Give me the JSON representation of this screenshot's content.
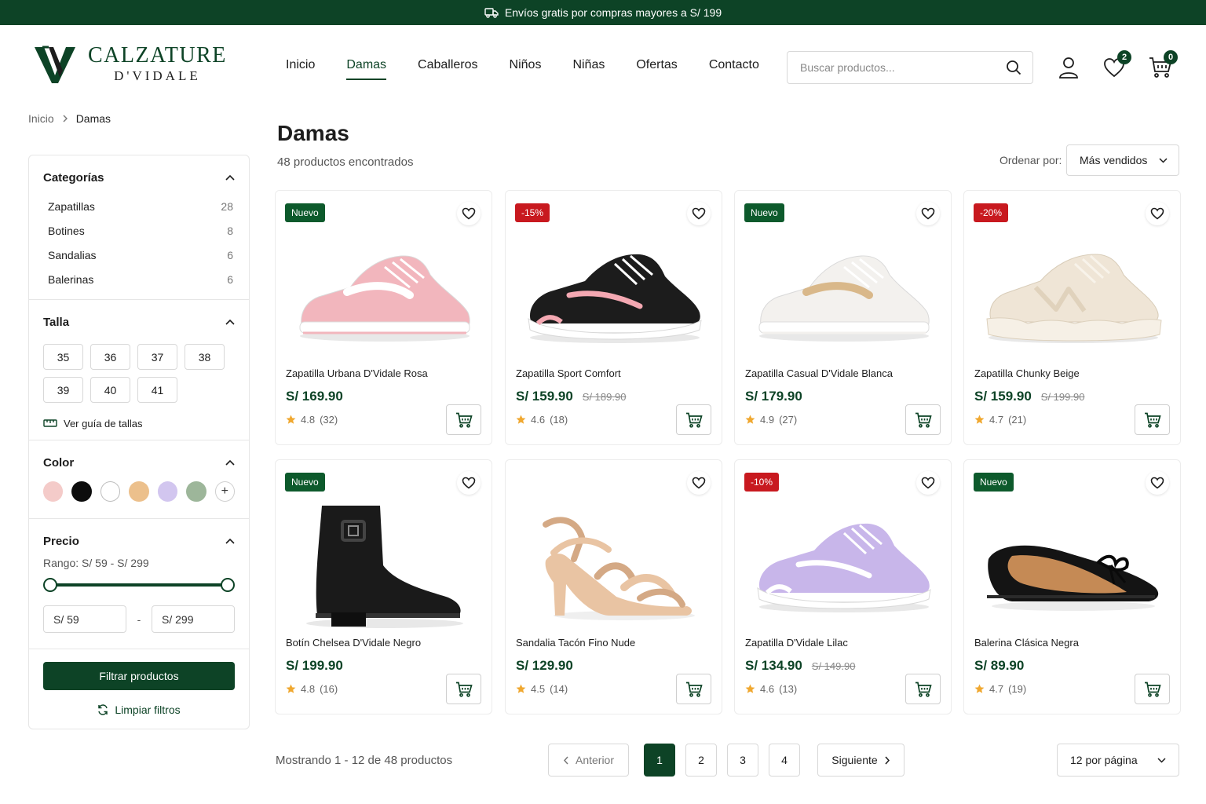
{
  "topbar": {
    "text": "Envíos gratis por compras mayores a S/ 199"
  },
  "brand": {
    "name": "CALZATURE",
    "sub": "D'VIDALE"
  },
  "nav": [
    {
      "label": "Inicio",
      "active": false
    },
    {
      "label": "Damas",
      "active": true
    },
    {
      "label": "Caballeros",
      "active": false
    },
    {
      "label": "Niños",
      "active": false
    },
    {
      "label": "Niñas",
      "active": false
    },
    {
      "label": "Ofertas",
      "active": false
    },
    {
      "label": "Contacto",
      "active": false
    }
  ],
  "search": {
    "placeholder": "Buscar productos..."
  },
  "header_icons": {
    "wishlist_count": "2",
    "cart_count": "0"
  },
  "breadcrumb": {
    "home": "Inicio",
    "current": "Damas"
  },
  "filters": {
    "categories": {
      "title": "Categorías",
      "items": [
        {
          "label": "Zapatillas",
          "count": "28"
        },
        {
          "label": "Botines",
          "count": "8"
        },
        {
          "label": "Sandalias",
          "count": "6"
        },
        {
          "label": "Balerinas",
          "count": "6"
        }
      ]
    },
    "size": {
      "title": "Talla",
      "options": [
        "35",
        "36",
        "37",
        "38",
        "39",
        "40",
        "41"
      ],
      "guide": "Ver guía de tallas"
    },
    "color": {
      "title": "Color",
      "swatches": [
        "#f4cbc9",
        "#0d0d0d",
        "#ffffff",
        "#ecc08c",
        "#d2c6ef",
        "#9db69a"
      ]
    },
    "price": {
      "title": "Precio",
      "range_text": "Rango: S/ 59 - S/ 299",
      "min": "S/ 59",
      "max": "S/ 299",
      "min_fraction": 0,
      "max_fraction": 1
    },
    "apply": "Filtrar productos",
    "clear": "Limpiar filtros"
  },
  "main": {
    "title": "Damas",
    "results": "48 productos encontrados",
    "sort_label": "Ordenar por:",
    "sort_value": "Más vendidos"
  },
  "products": [
    {
      "name": "Zapatilla Urbana D'Vidale Rosa",
      "price": "S/ 169.90",
      "old_price": "",
      "rating": "4.8",
      "reviews": "(32)",
      "tag": "Nuevo",
      "tag_type": "new",
      "shoe": "sneaker",
      "color": "#f2b6bd",
      "accent": "#ffffff"
    },
    {
      "name": "Zapatilla Sport Comfort",
      "price": "S/ 159.90",
      "old_price": "S/ 189.90",
      "rating": "4.6",
      "reviews": "(18)",
      "tag": "-15%",
      "tag_type": "sale",
      "shoe": "runner",
      "color": "#1c1c1c",
      "accent": "#f4a8b2"
    },
    {
      "name": "Zapatilla Casual D'Vidale Blanca",
      "price": "S/ 179.90",
      "old_price": "",
      "rating": "4.9",
      "reviews": "(27)",
      "tag": "Nuevo",
      "tag_type": "new",
      "shoe": "sneaker",
      "color": "#f3f1ee",
      "accent": "#d9b88a"
    },
    {
      "name": "Zapatilla Chunky Beige",
      "price": "S/ 159.90",
      "old_price": "S/ 199.90",
      "rating": "4.7",
      "reviews": "(21)",
      "tag": "-20%",
      "tag_type": "sale",
      "shoe": "chunky",
      "color": "#efe5d6",
      "accent": "#e0d2bc"
    },
    {
      "name": "Botín Chelsea D'Vidale Negro",
      "price": "S/ 199.90",
      "old_price": "",
      "rating": "4.8",
      "reviews": "(16)",
      "tag": "Nuevo",
      "tag_type": "new",
      "shoe": "boot",
      "color": "#1a1a1a",
      "accent": "#444444"
    },
    {
      "name": "Sandalia Tacón Fino Nude",
      "price": "S/ 129.90",
      "old_price": "",
      "rating": "4.5",
      "reviews": "(14)",
      "tag": "",
      "tag_type": "",
      "shoe": "sandal",
      "color": "#e9c4a3",
      "accent": "#d4a985"
    },
    {
      "name": "Zapatilla D'Vidale Lilac",
      "price": "S/ 134.90",
      "old_price": "S/ 149.90",
      "rating": "4.6",
      "reviews": "(13)",
      "tag": "-10%",
      "tag_type": "sale",
      "shoe": "runner",
      "color": "#c8b6ea",
      "accent": "#ffffff"
    },
    {
      "name": "Balerina Clásica Negra",
      "price": "S/ 89.90",
      "old_price": "",
      "rating": "4.7",
      "reviews": "(19)",
      "tag": "Nuevo",
      "tag_type": "new",
      "shoe": "flat",
      "color": "#141414",
      "accent": "#c58a55"
    }
  ],
  "pagination": {
    "showing": "Mostrando 1 - 12 de 48 productos",
    "prev": "Anterior",
    "next": "Siguiente",
    "pages": [
      "1",
      "2",
      "3",
      "4"
    ],
    "current": "1",
    "per_page": "12 por página"
  },
  "colors": {
    "brand": "#0d4326",
    "sale": "#c8191f",
    "star": "#f0a830"
  }
}
